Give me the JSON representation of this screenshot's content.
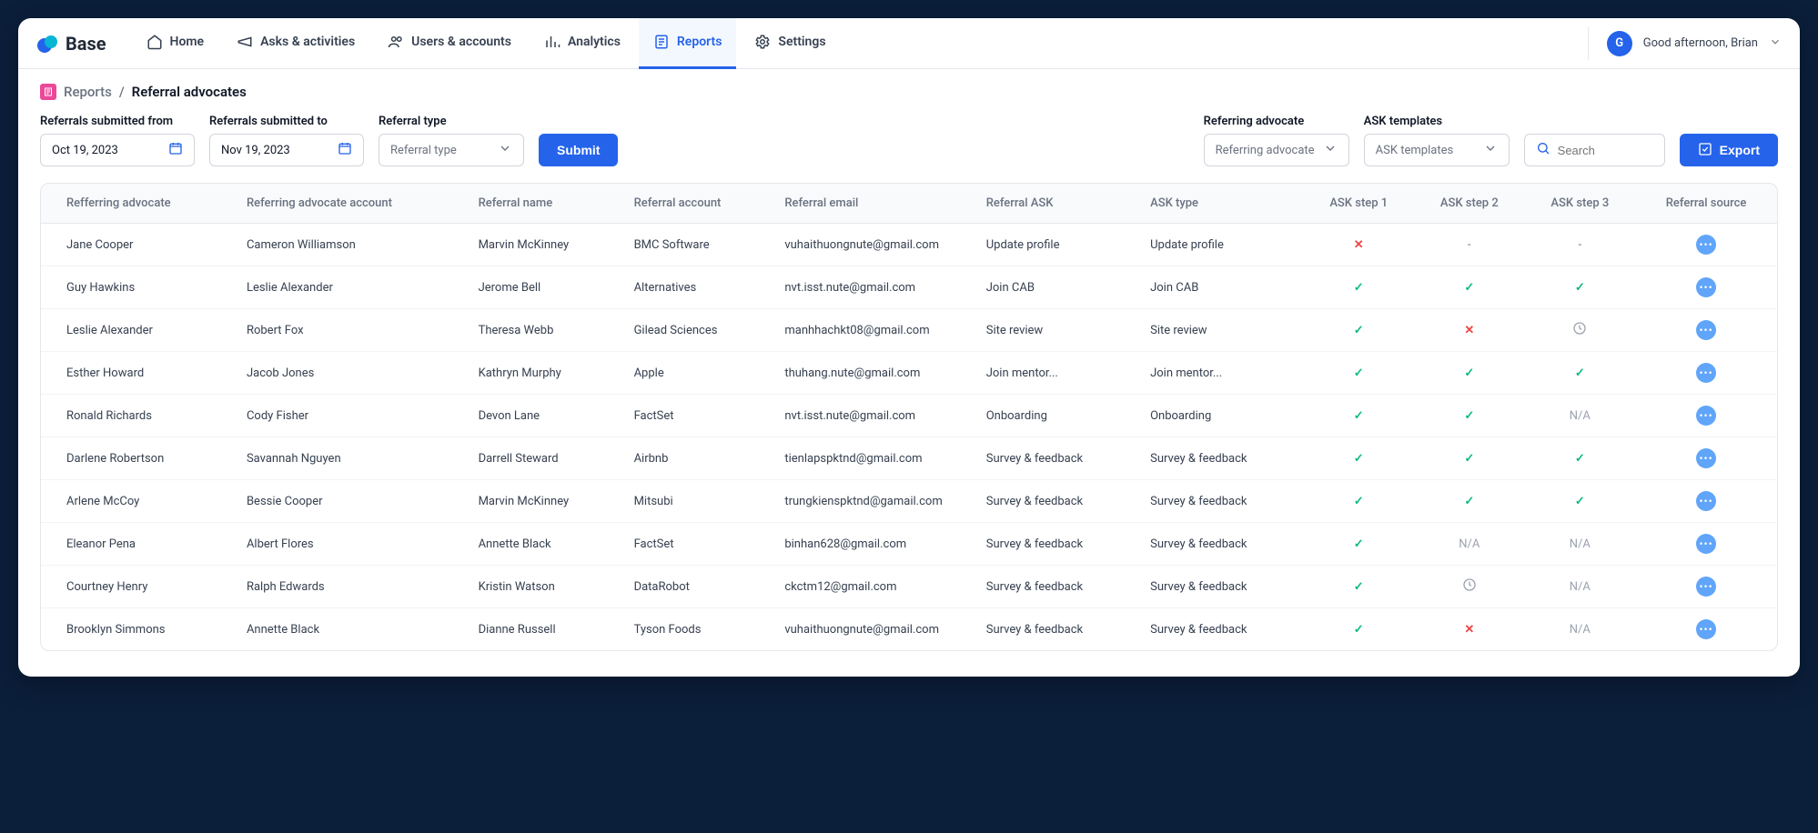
{
  "brand": "Base",
  "nav": {
    "home": "Home",
    "asks": "Asks & activities",
    "users": "Users & accounts",
    "analytics": "Analytics",
    "reports": "Reports",
    "settings": "Settings"
  },
  "user": {
    "avatar_initial": "G",
    "greeting": "Good afternoon, Brian"
  },
  "breadcrumb": {
    "parent": "Reports",
    "sep": "/",
    "current": "Referral advocates"
  },
  "filters": {
    "from_label": "Referrals submitted from",
    "from_value": "Oct 19, 2023",
    "to_label": "Referrals submitted to",
    "to_value": "Nov 19, 2023",
    "type_label": "Referral type",
    "type_placeholder": "Referral type",
    "submit": "Submit",
    "advocate_label": "Referring advocate",
    "advocate_placeholder": "Referring advocate",
    "templates_label": "ASK templates",
    "templates_placeholder": "ASK templates",
    "search_placeholder": "Search",
    "export": "Export"
  },
  "columns": {
    "c0": "Refferring advocate",
    "c1": "Referring advocate account",
    "c2": "Referral name",
    "c3": "Referral account",
    "c4": "Referral email",
    "c5": "Referral ASK",
    "c6": "ASK type",
    "c7": "ASK step 1",
    "c8": "ASK step 2",
    "c9": "ASK step 3",
    "c10": "Referral source"
  },
  "status_labels": {
    "na": "N/A",
    "dash": "-"
  },
  "rows": [
    {
      "advocate": "Jane Cooper",
      "account": "Cameron Williamson",
      "name": "Marvin McKinney",
      "raccount": "BMC Software",
      "email": "vuhaithuongnute@gmail.com",
      "ask": "Update profile",
      "type": "Update profile",
      "s1": "cross",
      "s2": "dash",
      "s3": "dash"
    },
    {
      "advocate": "Guy Hawkins",
      "account": "Leslie Alexander",
      "name": "Jerome Bell",
      "raccount": "Alternatives",
      "email": "nvt.isst.nute@gmail.com",
      "ask": "Join CAB",
      "type": "Join CAB",
      "s1": "check",
      "s2": "check",
      "s3": "check"
    },
    {
      "advocate": "Leslie Alexander",
      "account": "Robert Fox",
      "name": "Theresa Webb",
      "raccount": "Gilead Sciences",
      "email": "manhhachkt08@gmail.com",
      "ask": "Site review",
      "type": "Site review",
      "s1": "check",
      "s2": "cross",
      "s3": "clock"
    },
    {
      "advocate": "Esther Howard",
      "account": "Jacob Jones",
      "name": "Kathryn Murphy",
      "raccount": "Apple",
      "email": "thuhang.nute@gmail.com",
      "ask": "Join mentor...",
      "type": "Join mentor...",
      "s1": "check",
      "s2": "check",
      "s3": "check"
    },
    {
      "advocate": "Ronald Richards",
      "account": "Cody Fisher",
      "name": "Devon Lane",
      "raccount": "FactSet",
      "email": "nvt.isst.nute@gmail.com",
      "ask": "Onboarding",
      "type": "Onboarding",
      "s1": "check",
      "s2": "check",
      "s3": "na"
    },
    {
      "advocate": "Darlene Robertson",
      "account": "Savannah Nguyen",
      "name": "Darrell Steward",
      "raccount": "Airbnb",
      "email": "tienlapspktnd@gmail.com",
      "ask": "Survey & feedback",
      "type": "Survey & feedback",
      "s1": "check",
      "s2": "check",
      "s3": "check"
    },
    {
      "advocate": "Arlene McCoy",
      "account": "Bessie Cooper",
      "name": "Marvin McKinney",
      "raccount": "Mitsubi",
      "email": "trungkienspktnd@gamail.com",
      "ask": "Survey & feedback",
      "type": "Survey & feedback",
      "s1": "check",
      "s2": "check",
      "s3": "check"
    },
    {
      "advocate": "Eleanor Pena",
      "account": "Albert Flores",
      "name": "Annette Black",
      "raccount": "FactSet",
      "email": "binhan628@gmail.com",
      "ask": "Survey & feedback",
      "type": "Survey & feedback",
      "s1": "check",
      "s2": "na",
      "s3": "na"
    },
    {
      "advocate": "Courtney Henry",
      "account": "Ralph Edwards",
      "name": "Kristin Watson",
      "raccount": "DataRobot",
      "email": "ckctm12@gmail.com",
      "ask": "Survey & feedback",
      "type": "Survey & feedback",
      "s1": "check",
      "s2": "clock",
      "s3": "na"
    },
    {
      "advocate": "Brooklyn Simmons",
      "account": "Annette Black",
      "name": "Dianne Russell",
      "raccount": "Tyson Foods",
      "email": "vuhaithuongnute@gmail.com",
      "ask": "Survey & feedback",
      "type": "Survey & feedback",
      "s1": "check",
      "s2": "cross",
      "s3": "na"
    }
  ]
}
